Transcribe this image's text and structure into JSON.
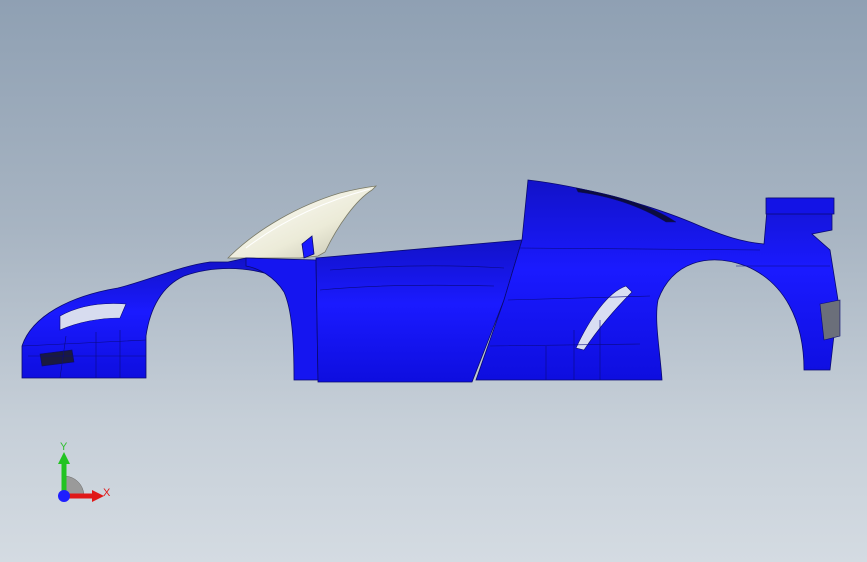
{
  "viewport": {
    "background_top": "#8fa0b3",
    "background_bottom": "#d4dbe2",
    "model": {
      "name": "car-body-shell",
      "body_color": "#0f0fe0",
      "canopy_color": "#efeedc",
      "grille_color": "#6b6f7a"
    }
  },
  "triad": {
    "y_label": "Y",
    "x_label": "X",
    "y_color": "#22c322",
    "x_color": "#e01818",
    "z_color": "#1e1eff"
  }
}
